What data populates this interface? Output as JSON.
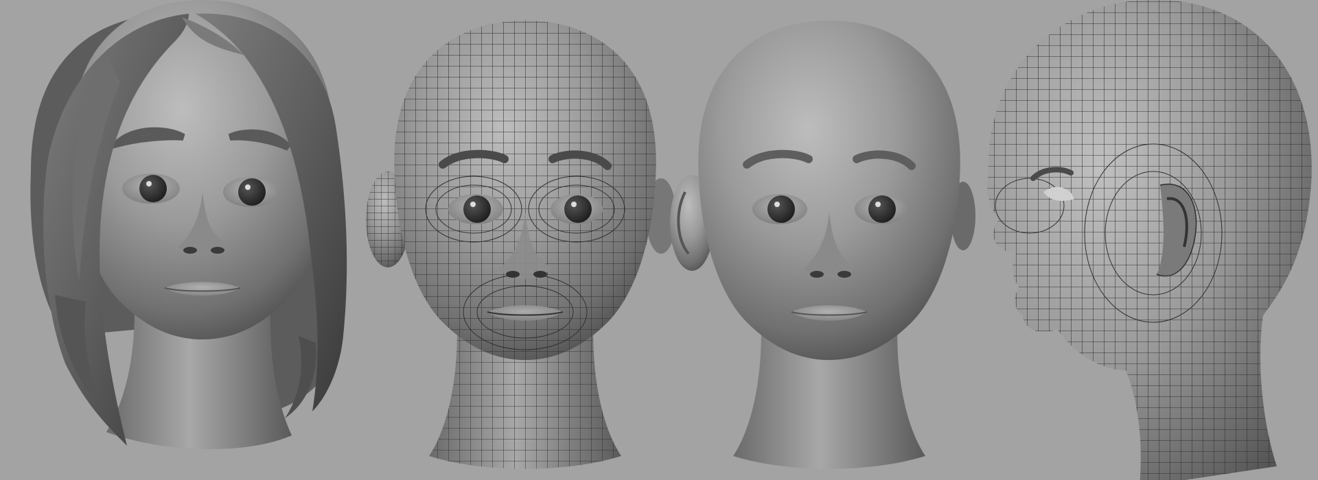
{
  "scene": {
    "background_color": "#a3a3a3",
    "material_color": "#8c8c8c",
    "wire_color": "#2b2b2b",
    "views": [
      {
        "id": "hair-front",
        "shading": "smooth",
        "has_hair": true
      },
      {
        "id": "wire-front",
        "shading": "wireframe",
        "has_hair": false
      },
      {
        "id": "smooth-front",
        "shading": "smooth",
        "has_hair": false
      },
      {
        "id": "wire-side",
        "shading": "wireframe",
        "has_hair": false
      }
    ]
  }
}
